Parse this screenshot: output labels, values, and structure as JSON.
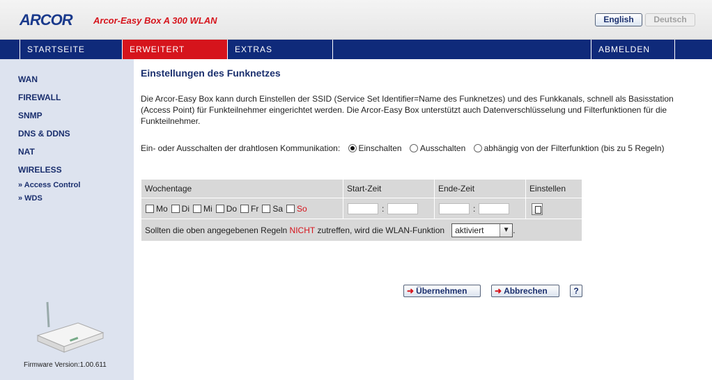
{
  "header": {
    "logo_text": "ARCOR",
    "product": "Arcor-Easy Box A 300 WLAN",
    "lang_english": "English",
    "lang_deutsch": "Deutsch"
  },
  "nav": {
    "startseite": "STARTSEITE",
    "erweitert": "ERWEITERT",
    "extras": "EXTRAS",
    "abmelden": "ABMELDEN"
  },
  "sidebar": {
    "items": [
      "WAN",
      "FIREWALL",
      "SNMP",
      "DNS & DDNS",
      "NAT",
      "WIRELESS"
    ],
    "sub_items": [
      "» Access Control",
      "» WDS"
    ],
    "firmware": "Firmware Version:1.00.611"
  },
  "main": {
    "title": "Einstellungen des Funknetzes",
    "description": "Die Arcor-Easy Box kann durch Einstellen der SSID (Service Set Identifier=Name des Funknetzes) und des Funkkanals, schnell als Basisstation (Access Point) für Funkteilnehmer eingerichtet werden. Die Arcor-Easy Box unterstützt auch Datenverschlüsselung und Filterfunktionen für die Funkteilnehmer.",
    "radio_label": "Ein- oder Ausschalten der drahtlosen Kommunikation:",
    "radio_on": "Einschalten",
    "radio_off": "Ausschalten",
    "radio_filter": "abhängig von der Filterfunktion (bis zu 5 Regeln)",
    "selected_radio": "Einschalten",
    "table": {
      "headers": [
        "Wochentage",
        "Start-Zeit",
        "Ende-Zeit",
        "Einstellen"
      ],
      "days": [
        "Mo",
        "Di",
        "Mi",
        "Do",
        "Fr",
        "Sa",
        "So"
      ],
      "colon": ":",
      "rule_before": "Sollten die oben angegebenen Regeln",
      "rule_highlight": "NICHT",
      "rule_after": "zutreffen, wird die WLAN-Funktion",
      "rule_end": ".",
      "select_value": "aktiviert"
    },
    "buttons": {
      "ok": "Übernehmen",
      "cancel": "Abbrechen",
      "help": "?"
    }
  },
  "colors": {
    "brand_blue": "#0f2a7a",
    "brand_red": "#d6141c",
    "sidebar_bg": "#dde3ef"
  }
}
